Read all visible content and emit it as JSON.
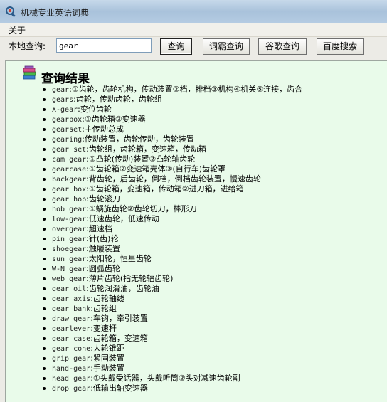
{
  "window": {
    "title": "机械专业英语词典"
  },
  "menu": {
    "about": "关于"
  },
  "toolbar": {
    "local_label": "本地查询:",
    "search_value": "gear",
    "query_button": "查询",
    "ciba_button": "词霸查询",
    "google_button": "谷歌查询",
    "baidu_button": "百度搜索"
  },
  "results": {
    "title": "查询结果",
    "items": [
      {
        "term": "gear",
        "def": "①齿轮，齿轮机构，传动装置②档，排档③机构④机关⑤连接，齿合"
      },
      {
        "term": "gears",
        "def": "齿轮，传动齿轮，齿轮组"
      },
      {
        "term": "X-gear",
        "def": "变位齿轮"
      },
      {
        "term": "gearbox",
        "def": "①齿轮箱②变速器"
      },
      {
        "term": "gearset",
        "def": "主传动总成"
      },
      {
        "term": "gearing",
        "def": "传动装置，齿轮传动，齿轮装置"
      },
      {
        "term": "gear set",
        "def": "齿轮组，齿轮箱，变速箱，传动箱"
      },
      {
        "term": "cam gear",
        "def": "①凸轮(传动)装置②凸轮轴齿轮"
      },
      {
        "term": "gearcase",
        "def": "①齿轮箱②变速箱壳体③(自行车)齿轮罩"
      },
      {
        "term": "backgear",
        "def": "背齿轮，后齿轮，倒档，倒档齿轮装置，慢速齿轮"
      },
      {
        "term": "gear box",
        "def": "①齿轮箱，变速箱，传动箱②进刀箱，进给箱"
      },
      {
        "term": "gear hob",
        "def": "齿轮滚刀"
      },
      {
        "term": "hob gear",
        "def": "①蜗旋齿轮②齿轮切刀，棒形刀"
      },
      {
        "term": "low-gear",
        "def": "低速齿轮，低速传动"
      },
      {
        "term": "overgear",
        "def": "超速档"
      },
      {
        "term": "pin gear",
        "def": "针(齿)轮"
      },
      {
        "term": "shoegear",
        "def": "触履装置"
      },
      {
        "term": "sun gear",
        "def": "太阳轮，恒星齿轮"
      },
      {
        "term": "W-N gear",
        "def": "圆弧齿轮"
      },
      {
        "term": "web gear",
        "def": "薄片齿轮(指无轮辐齿轮)"
      },
      {
        "term": "gear oil",
        "def": "齿轮润滑油，齿轮油"
      },
      {
        "term": "gear axis",
        "def": "齿轮轴线"
      },
      {
        "term": "gear bank",
        "def": "齿轮组"
      },
      {
        "term": "draw gear",
        "def": "车钩，牵引装置"
      },
      {
        "term": "gearlever",
        "def": "变速杆"
      },
      {
        "term": "gear case",
        "def": "齿轮箱，变速箱"
      },
      {
        "term": "gear cone",
        "def": "大轮锥距"
      },
      {
        "term": "grip gear",
        "def": "紧固装置"
      },
      {
        "term": "hand-gear",
        "def": "手动装置"
      },
      {
        "term": "head gear",
        "def": "①头戴受话器，头戴听筒②头对减速齿轮副"
      },
      {
        "term": "drop gear",
        "def": "低输出轴变速器"
      }
    ]
  }
}
